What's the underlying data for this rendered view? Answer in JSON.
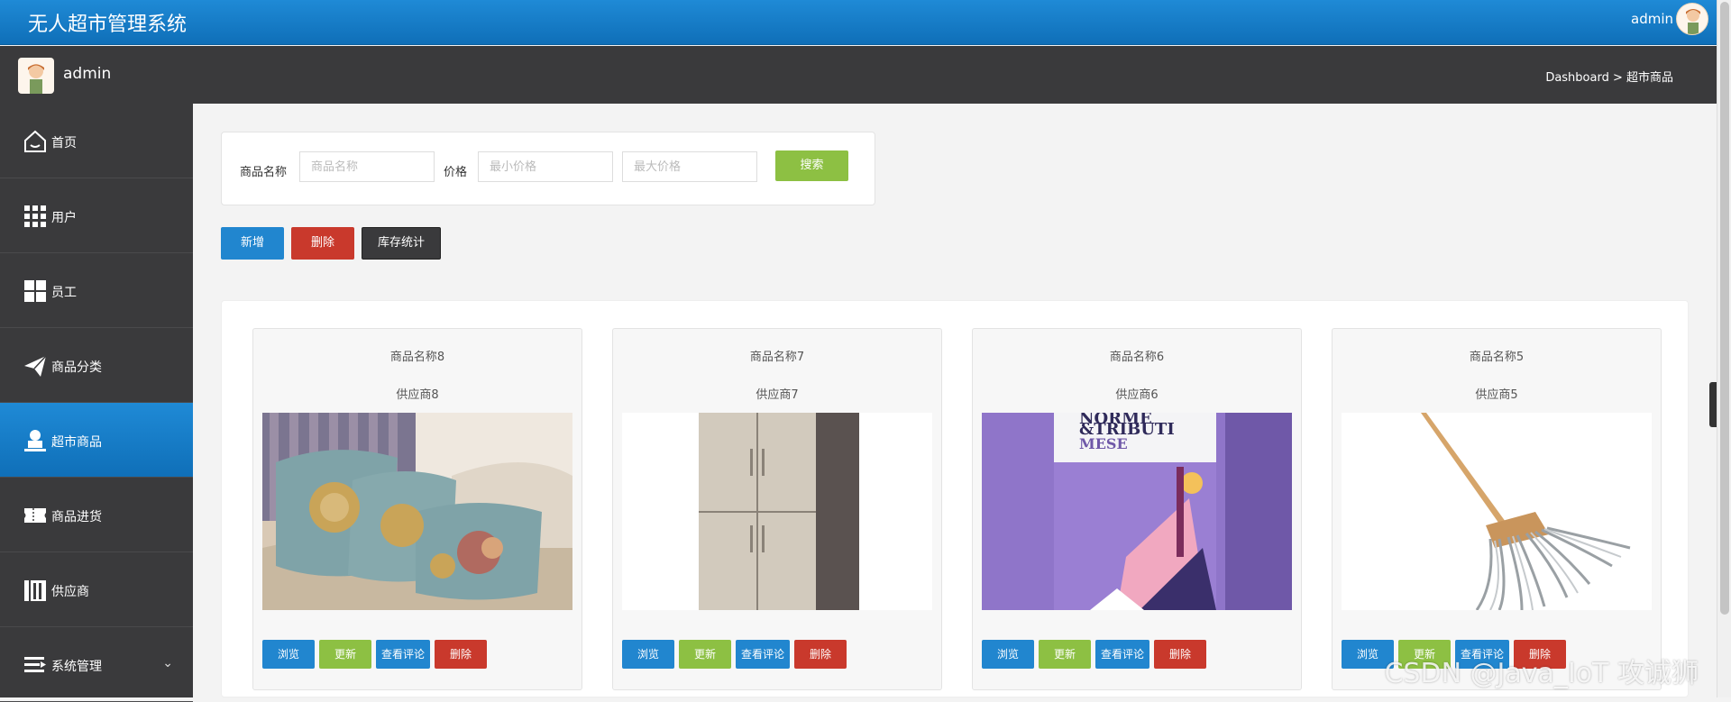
{
  "header": {
    "title": "无人超市管理系统",
    "user": "admin"
  },
  "subheader": {
    "user": "admin",
    "breadcrumb": "Dashboard > 超市商品"
  },
  "sidebar": {
    "items": [
      {
        "label": "首页",
        "icon": "home-icon"
      },
      {
        "label": "用户",
        "icon": "grid-icon"
      },
      {
        "label": "员工",
        "icon": "tiles-icon"
      },
      {
        "label": "商品分类",
        "icon": "paper-plane-icon"
      },
      {
        "label": "超市商品",
        "icon": "user-icon",
        "active": true
      },
      {
        "label": "商品进货",
        "icon": "ticket-icon"
      },
      {
        "label": "供应商",
        "icon": "building-icon"
      },
      {
        "label": "系统管理",
        "icon": "list-icon",
        "has_submenu": true
      }
    ]
  },
  "search": {
    "name_label": "商品名称",
    "name_placeholder": "商品名称",
    "price_label": "价格",
    "min_placeholder": "最小价格",
    "max_placeholder": "最大价格",
    "search_button": "搜索"
  },
  "toolbar": {
    "add": "新增",
    "delete": "删除",
    "stock": "库存统计"
  },
  "products": [
    {
      "name": "商品名称8",
      "supplier": "供应商8",
      "image": "pillows"
    },
    {
      "name": "商品名称7",
      "supplier": "供应商7",
      "image": "refrigerator"
    },
    {
      "name": "商品名称6",
      "supplier": "供应商6",
      "image": "poster"
    },
    {
      "name": "商品名称5",
      "supplier": "供应商5",
      "image": "mop"
    }
  ],
  "card_actions": {
    "view": "浏览",
    "update": "更新",
    "comments": "查看评论",
    "delete": "删除"
  },
  "poster_text": {
    "line1": "NORME",
    "line2": "&TRIBUTI",
    "line3": "MESE"
  },
  "watermark": "CSDN @Java_IoT 攻诚狮",
  "colors": {
    "primary": "#1f8ad6",
    "success": "#8dc043",
    "danger": "#c9392c",
    "dark": "#3a3a3c"
  }
}
